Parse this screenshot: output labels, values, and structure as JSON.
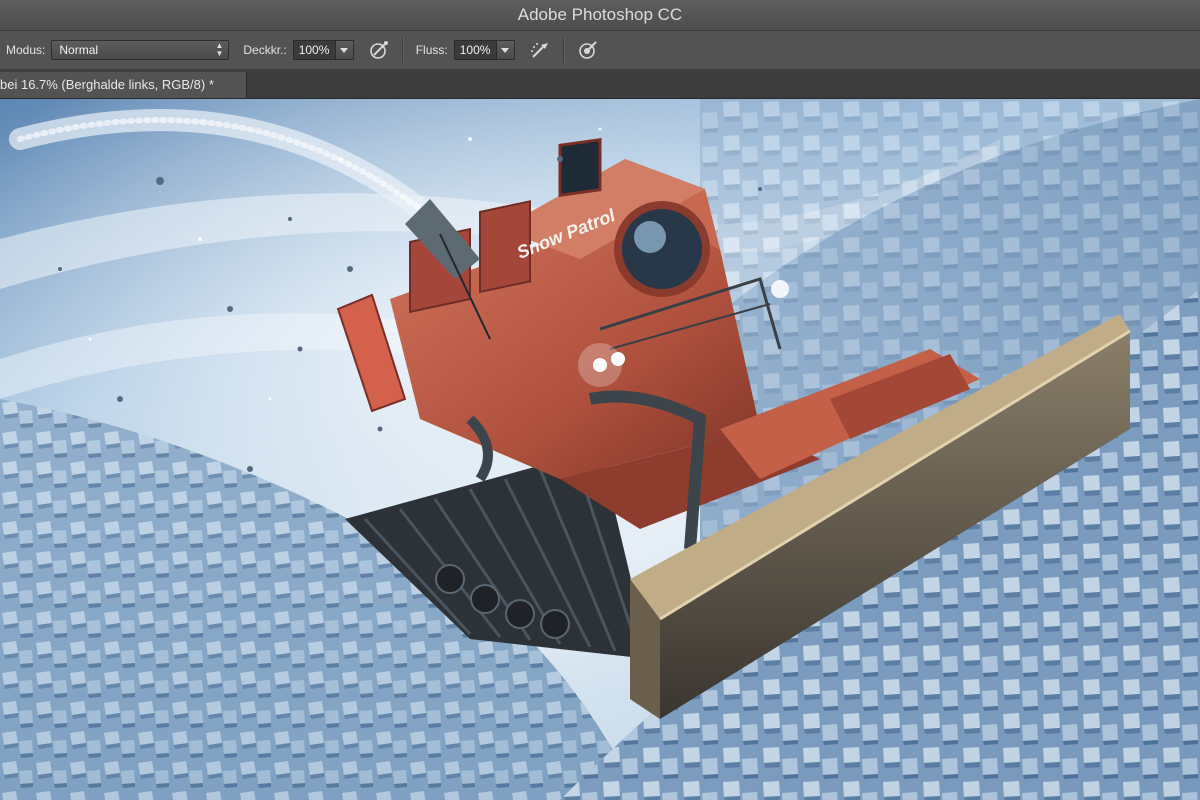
{
  "app": {
    "title": "Adobe Photoshop CC"
  },
  "options": {
    "mode_label": "Modus:",
    "mode_value": "Normal",
    "opacity_label": "Deckkr.:",
    "opacity_value": "100%",
    "flow_label": "Fluss:",
    "flow_value": "100%",
    "icons": [
      "airbrush-pressure-icon",
      "airbrush-icon",
      "tablet-pressure-size-icon"
    ]
  },
  "document": {
    "tab_title": "bei 16.7% (Berghalde links, RGB/8) *"
  },
  "artwork": {
    "vehicle_label": "Snow Patrol",
    "colors": {
      "sky": "#8fb4d6",
      "snow": "#a9c3dc",
      "vehicle": "#b8533f",
      "track": "#2c3238"
    }
  }
}
